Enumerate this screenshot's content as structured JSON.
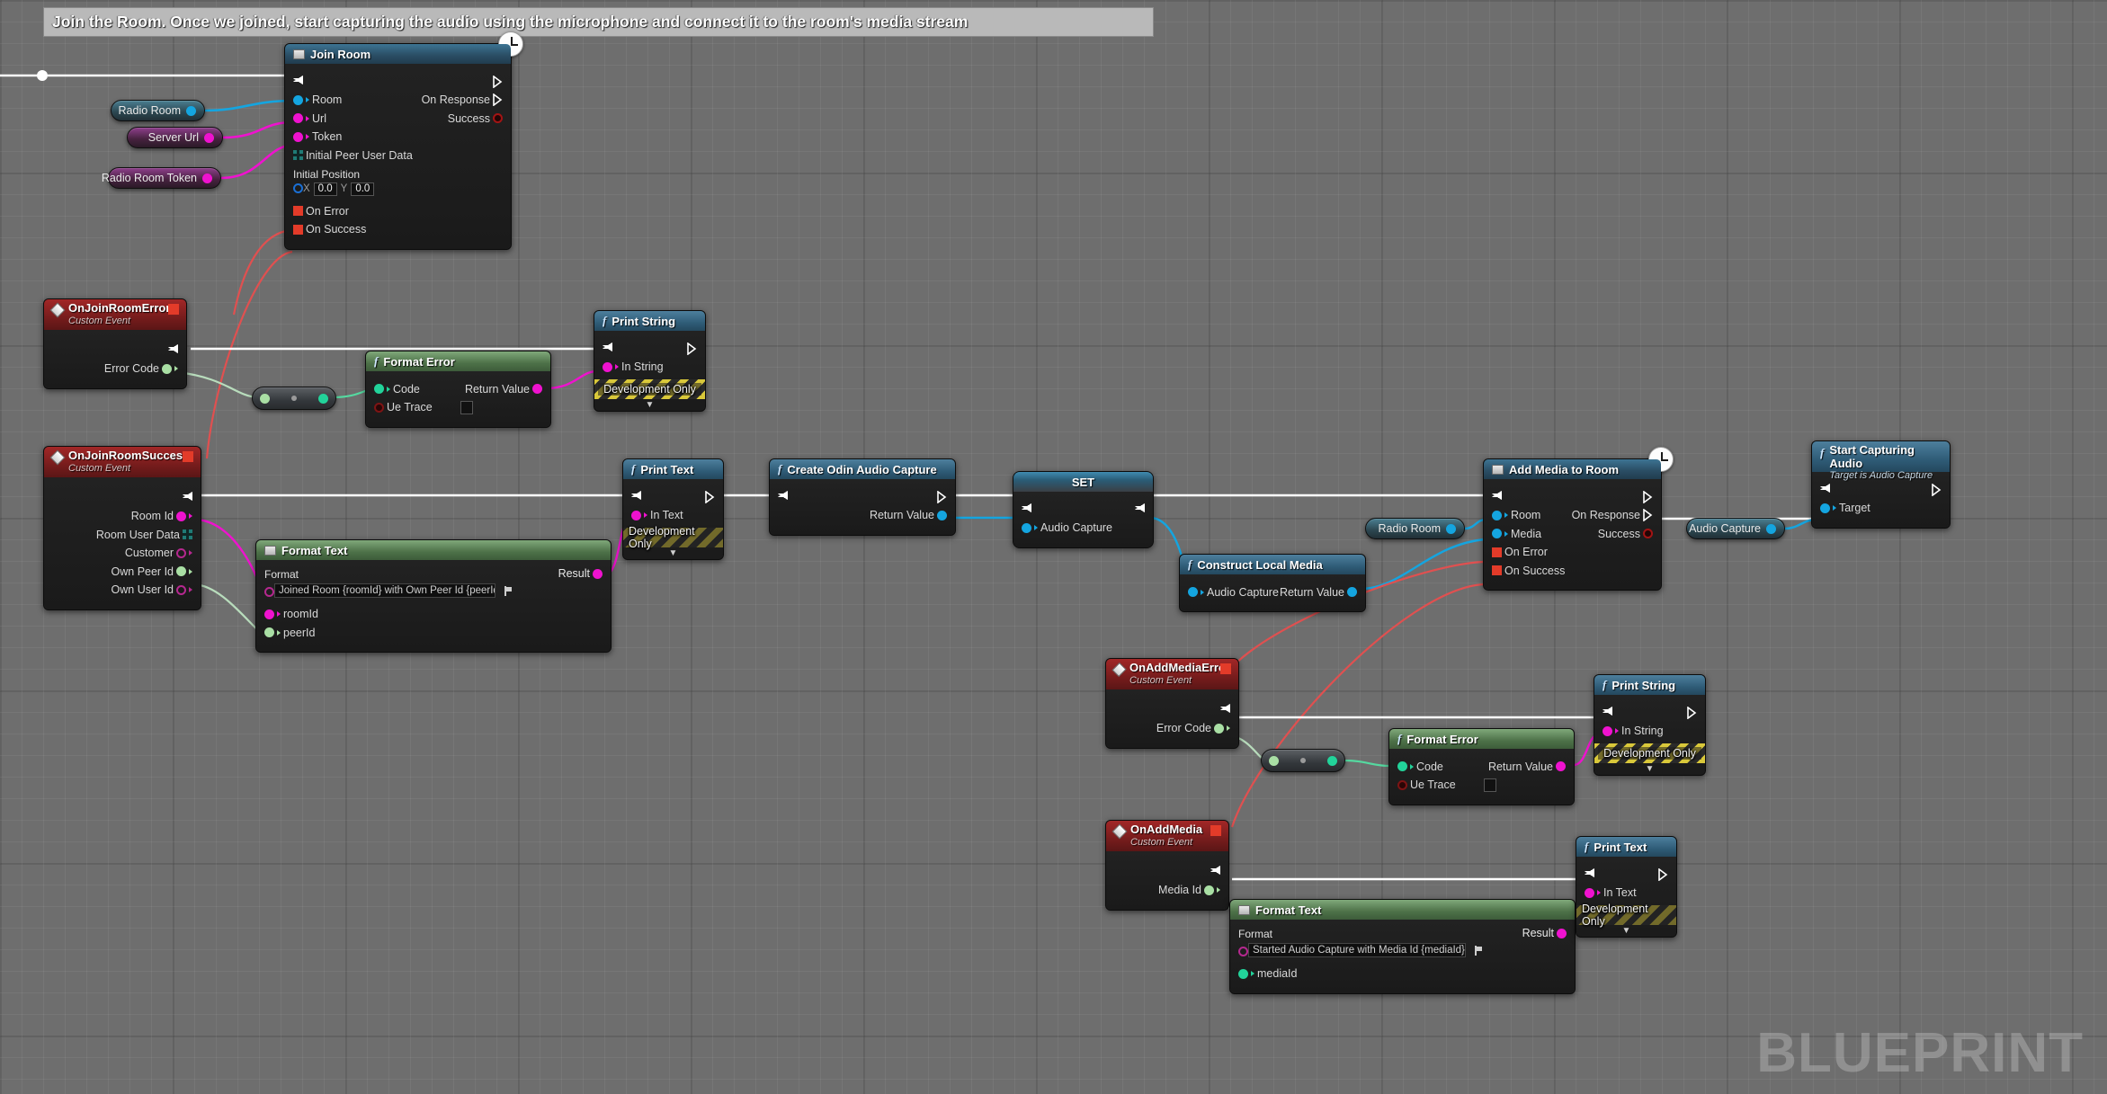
{
  "comment": {
    "text": "Join the Room. Once we joined, start capturing the audio using the microphone and connect it to the room's media stream"
  },
  "watermark": "BLUEPRINT",
  "variables": [
    {
      "name": "radio-room",
      "label": "Radio Room",
      "pin": "cyan"
    },
    {
      "name": "server-url",
      "label": "Server Url",
      "pin": "magenta"
    },
    {
      "name": "radio-room-token",
      "label": "Radio Room Token",
      "pin": "magenta"
    },
    {
      "name": "radio-room-2",
      "label": "Radio Room",
      "pin": "cyan"
    },
    {
      "name": "audio-capture",
      "label": "Audio Capture",
      "pin": "cyan"
    }
  ],
  "nodes": {
    "join_room": {
      "title": "Join Room",
      "icon": "square-icon",
      "latent": true,
      "inputs": [
        {
          "label": "Room",
          "pin": "cyan"
        },
        {
          "label": "Url",
          "pin": "magenta"
        },
        {
          "label": "Token",
          "pin": "magenta"
        },
        {
          "label": "Initial Peer User Data",
          "pin": "struct"
        }
      ],
      "initial_position": {
        "label": "Initial Position",
        "x_axis": "X",
        "x": "0.0",
        "y_axis": "Y",
        "y": "0.0"
      },
      "delegates": [
        {
          "label": "On Error",
          "pin": "red-square"
        },
        {
          "label": "On Success",
          "pin": "red-square"
        }
      ],
      "outputs": [
        {
          "label": "On Response",
          "pin": "exec-hollow"
        },
        {
          "label": "Success",
          "pin": "red-ring"
        }
      ]
    },
    "on_join_room_error": {
      "title": "OnJoinRoomError",
      "subtitle": "Custom Event",
      "outputs": [
        {
          "label": "Error Code",
          "pin": "lgreen"
        }
      ]
    },
    "format_error_1": {
      "title": "Format Error",
      "inputs": [
        {
          "label": "Code",
          "pin": "teal"
        },
        {
          "label": "Ue Trace",
          "pin": "red-ring"
        }
      ],
      "outputs": [
        {
          "label": "Return Value",
          "pin": "magenta"
        }
      ]
    },
    "print_string_1": {
      "title": "Print String",
      "inputs": [
        {
          "label": "In String",
          "pin": "magenta"
        }
      ],
      "dev_only": "Development Only"
    },
    "on_join_room_success": {
      "title": "OnJoinRoomSuccess",
      "subtitle": "Custom Event",
      "outputs": [
        {
          "label": "Room Id",
          "pin": "magenta"
        },
        {
          "label": "Room User Data",
          "pin": "struct"
        },
        {
          "label": "Customer",
          "pin": "purple-ring"
        },
        {
          "label": "Own Peer Id",
          "pin": "lgreen"
        },
        {
          "label": "Own User Id",
          "pin": "purple-ring"
        }
      ]
    },
    "format_text_1": {
      "title": "Format Text",
      "format_label": "Format",
      "format_value": "Joined Room {roomId} with Own Peer Id {peerId}",
      "inputs": [
        {
          "label": "roomId",
          "pin": "magenta"
        },
        {
          "label": "peerId",
          "pin": "lgreen"
        }
      ],
      "outputs": [
        {
          "label": "Result",
          "pin": "magenta"
        }
      ]
    },
    "print_text_1": {
      "title": "Print Text",
      "inputs": [
        {
          "label": "In Text",
          "pin": "magenta"
        }
      ],
      "dev_only": "Development Only"
    },
    "create_odin_audio_capture": {
      "title": "Create Odin Audio Capture",
      "outputs": [
        {
          "label": "Return Value",
          "pin": "cyan"
        }
      ]
    },
    "set_audio_capture": {
      "title": "SET",
      "inputs": [
        {
          "label": "Audio Capture",
          "pin": "cyan"
        }
      ]
    },
    "construct_local_media": {
      "title": "Construct Local Media",
      "inputs": [
        {
          "label": "Audio Capture",
          "pin": "cyan"
        }
      ],
      "outputs": [
        {
          "label": "Return Value",
          "pin": "cyan"
        }
      ]
    },
    "add_media_to_room": {
      "title": "Add Media to Room",
      "icon": "square-icon",
      "latent": true,
      "inputs": [
        {
          "label": "Room",
          "pin": "cyan"
        },
        {
          "label": "Media",
          "pin": "cyan"
        }
      ],
      "delegates": [
        {
          "label": "On Error",
          "pin": "red-square"
        },
        {
          "label": "On Success",
          "pin": "red-square"
        }
      ],
      "outputs": [
        {
          "label": "On Response",
          "pin": "exec-hollow"
        },
        {
          "label": "Success",
          "pin": "red-ring"
        }
      ]
    },
    "start_capturing_audio": {
      "title": "Start Capturing Audio",
      "subtitle": "Target is Audio Capture",
      "inputs": [
        {
          "label": "Target",
          "pin": "cyan"
        }
      ]
    },
    "on_add_media_error": {
      "title": "OnAddMediaError",
      "subtitle": "Custom Event",
      "outputs": [
        {
          "label": "Error Code",
          "pin": "lgreen"
        }
      ]
    },
    "format_error_2": {
      "title": "Format Error",
      "inputs": [
        {
          "label": "Code",
          "pin": "teal"
        },
        {
          "label": "Ue Trace",
          "pin": "red-ring"
        }
      ],
      "outputs": [
        {
          "label": "Return Value",
          "pin": "magenta"
        }
      ]
    },
    "print_string_2": {
      "title": "Print String",
      "inputs": [
        {
          "label": "In String",
          "pin": "magenta"
        }
      ],
      "dev_only": "Development Only"
    },
    "on_add_media": {
      "title": "OnAddMedia",
      "subtitle": "Custom Event",
      "outputs": [
        {
          "label": "Media Id",
          "pin": "lgreen"
        }
      ]
    },
    "format_text_2": {
      "title": "Format Text",
      "format_label": "Format",
      "format_value": "Started Audio Capture with Media Id {mediaId}",
      "inputs": [
        {
          "label": "mediaId",
          "pin": "teal"
        }
      ],
      "outputs": [
        {
          "label": "Result",
          "pin": "magenta"
        }
      ]
    },
    "print_text_2": {
      "title": "Print Text",
      "inputs": [
        {
          "label": "In Text",
          "pin": "magenta"
        }
      ],
      "dev_only": "Development Only"
    }
  },
  "colors": {
    "exec": "#ffffff",
    "object": "#14a5e0",
    "string": "#ef12cf",
    "text": "#ef12cf",
    "int": "#6fe3a8",
    "event": "#a22727",
    "bool": "#a31414",
    "struct": "#1f7b76"
  }
}
